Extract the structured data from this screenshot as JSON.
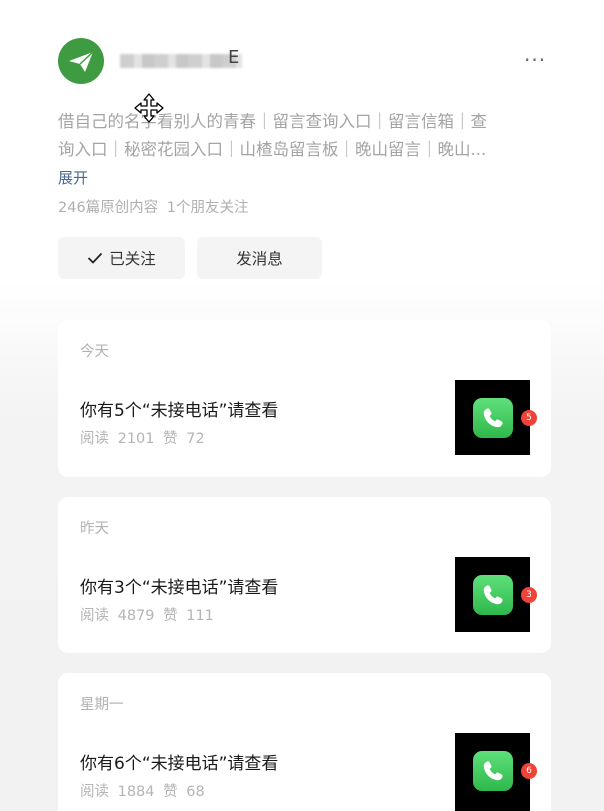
{
  "profile": {
    "name_visible_part": "E",
    "more_label": "···",
    "description_line1": "借自己的名字看别人的青春｜留言查询入口｜留言信箱｜查",
    "description_line2": "询入口｜秘密花园入口｜山楂岛留言板｜晚山留言｜晚山...",
    "expand_label": "展开",
    "stats": "246篇原创内容 1个朋友关注",
    "follow_label": "已关注",
    "message_label": "发消息"
  },
  "articles": [
    {
      "date": "今天",
      "title": "你有5个“未接电话”请查看",
      "meta": "阅读 2101 赞 72",
      "badge": "5"
    },
    {
      "date": "昨天",
      "title": "你有3个“未接电话”请查看",
      "meta": "阅读 4879 赞 111",
      "badge": "3"
    },
    {
      "date": "星期一",
      "title": "你有6个“未接电话”请查看",
      "meta": "阅读 1884 赞 68",
      "badge": "6"
    }
  ],
  "colors": {
    "avatar": "#3f9b41",
    "link": "#4a6a92",
    "badge": "#f04236",
    "phone_app": "#36c256"
  },
  "icons": [
    "paper-plane-icon",
    "more-icon",
    "move-cursor-icon",
    "check-icon",
    "phone-icon"
  ]
}
